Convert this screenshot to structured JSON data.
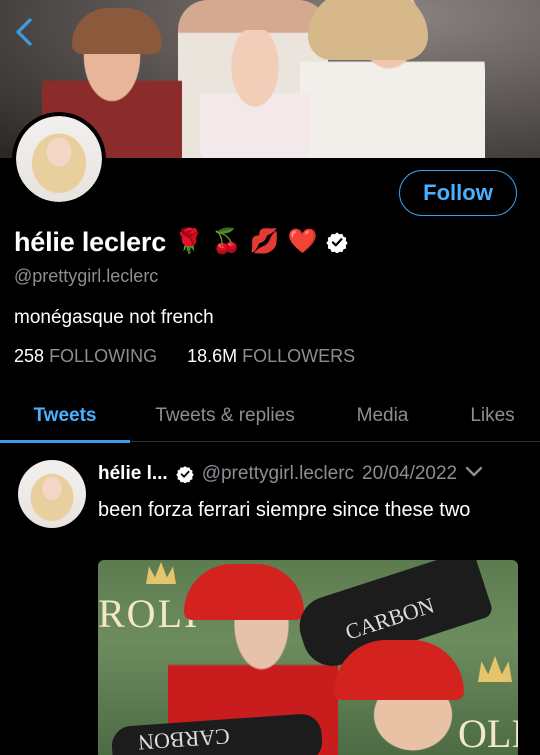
{
  "profile": {
    "name": "hélie leclerc",
    "name_emojis": [
      "🌹",
      "🍒",
      "💋",
      "❤️"
    ],
    "handle": "@prettygirl.leclerc",
    "bio": "monégasque not french",
    "following_count": "258",
    "following_label": "FOLLOWING",
    "followers_count": "18.6M",
    "followers_label": "FOLLOWERS",
    "follow_label": "Follow"
  },
  "tabs": [
    {
      "label": "Tweets",
      "active": true
    },
    {
      "label": "Tweets & replies",
      "active": false
    },
    {
      "label": "Media",
      "active": false
    },
    {
      "label": "Likes",
      "active": false
    }
  ],
  "tweet": {
    "name": "hélie l...",
    "handle": "@prettygirl.leclerc",
    "date": "20/04/2022",
    "text": "been forza ferrari siempre since these two",
    "media_text": {
      "rolex_left": "ROLI",
      "rolex_right": "OLI",
      "carbon_top": "CARBON",
      "carbon_bottom": "CARBON"
    }
  },
  "colors": {
    "accent": "#3b9de6",
    "secondary_text": "#8b8f94",
    "background": "#000000"
  },
  "icons": {
    "back": "chevron-left-icon",
    "verified": "verified-badge-icon",
    "tweet_menu": "chevron-down-icon"
  }
}
